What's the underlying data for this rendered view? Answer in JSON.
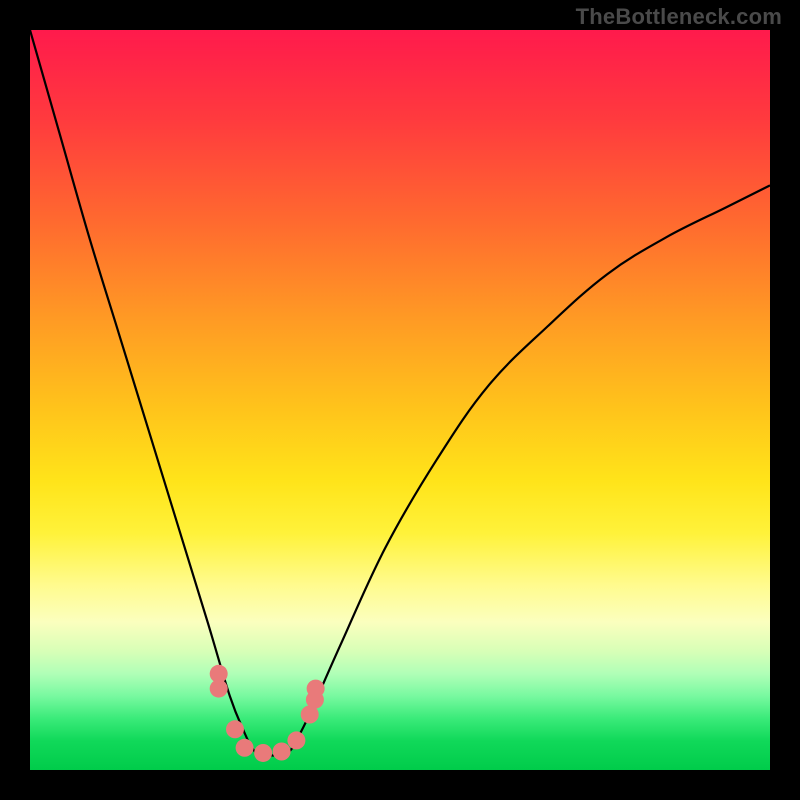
{
  "watermark": "TheBottleneck.com",
  "colors": {
    "frame": "#000000",
    "curve": "#000000",
    "dot": "#e97a7a",
    "watermark_text": "#4a4a4a"
  },
  "chart_data": {
    "type": "line",
    "title": "",
    "xlabel": "",
    "ylabel": "",
    "xlim": [
      0,
      100
    ],
    "ylim": [
      0,
      100
    ],
    "x": [
      0,
      4,
      8,
      12,
      16,
      20,
      24,
      27,
      29,
      30,
      31,
      32,
      33.5,
      35,
      36,
      38,
      42,
      48,
      55,
      62,
      70,
      78,
      86,
      94,
      100
    ],
    "y": [
      100,
      86,
      72,
      59,
      46,
      33,
      20,
      10,
      5,
      3,
      2,
      2,
      2,
      2.5,
      4,
      8,
      17,
      30,
      42,
      52,
      60,
      67,
      72,
      76,
      79
    ],
    "notes": "V-shaped bottleneck curve; minimum near x≈32, y≈2; background gradient from red (top, high bottleneck) to green (bottom, low bottleneck)."
  },
  "dots": {
    "points": [
      {
        "x_pct": 25.5,
        "y_pct": 13.0
      },
      {
        "x_pct": 25.5,
        "y_pct": 11.0
      },
      {
        "x_pct": 27.7,
        "y_pct": 5.5
      },
      {
        "x_pct": 29.0,
        "y_pct": 3.0
      },
      {
        "x_pct": 31.5,
        "y_pct": 2.3
      },
      {
        "x_pct": 34.0,
        "y_pct": 2.5
      },
      {
        "x_pct": 36.0,
        "y_pct": 4.0
      },
      {
        "x_pct": 37.8,
        "y_pct": 7.5
      },
      {
        "x_pct": 38.5,
        "y_pct": 9.5
      },
      {
        "x_pct": 38.6,
        "y_pct": 11.0
      }
    ],
    "radius_px": 9
  }
}
